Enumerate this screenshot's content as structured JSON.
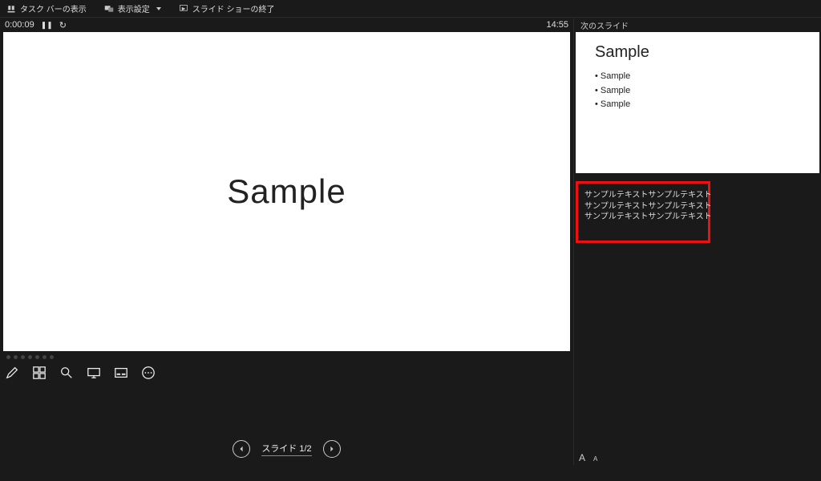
{
  "topbar": {
    "taskbar_label": "タスク バーの表示",
    "display_settings_label": "表示設定",
    "end_show_label": "スライド ショーの終了"
  },
  "timer": {
    "elapsed": "0:00:09",
    "pause_glyph": "❚❚",
    "reset_glyph": "↻",
    "clock": "14:55"
  },
  "current_slide": {
    "title": "Sample"
  },
  "nav": {
    "label": "スライド 1/2"
  },
  "right_header": "次のスライド",
  "next_slide": {
    "title": "Sample",
    "bullets": [
      "Sample",
      "Sample",
      "Sample"
    ]
  },
  "notes": {
    "lines": [
      "サンプルテキストサンプルテキスト",
      "サンプルテキストサンプルテキスト",
      "サンプルテキストサンプルテキスト"
    ]
  },
  "font_controls": {
    "big": "A",
    "small": "A"
  }
}
